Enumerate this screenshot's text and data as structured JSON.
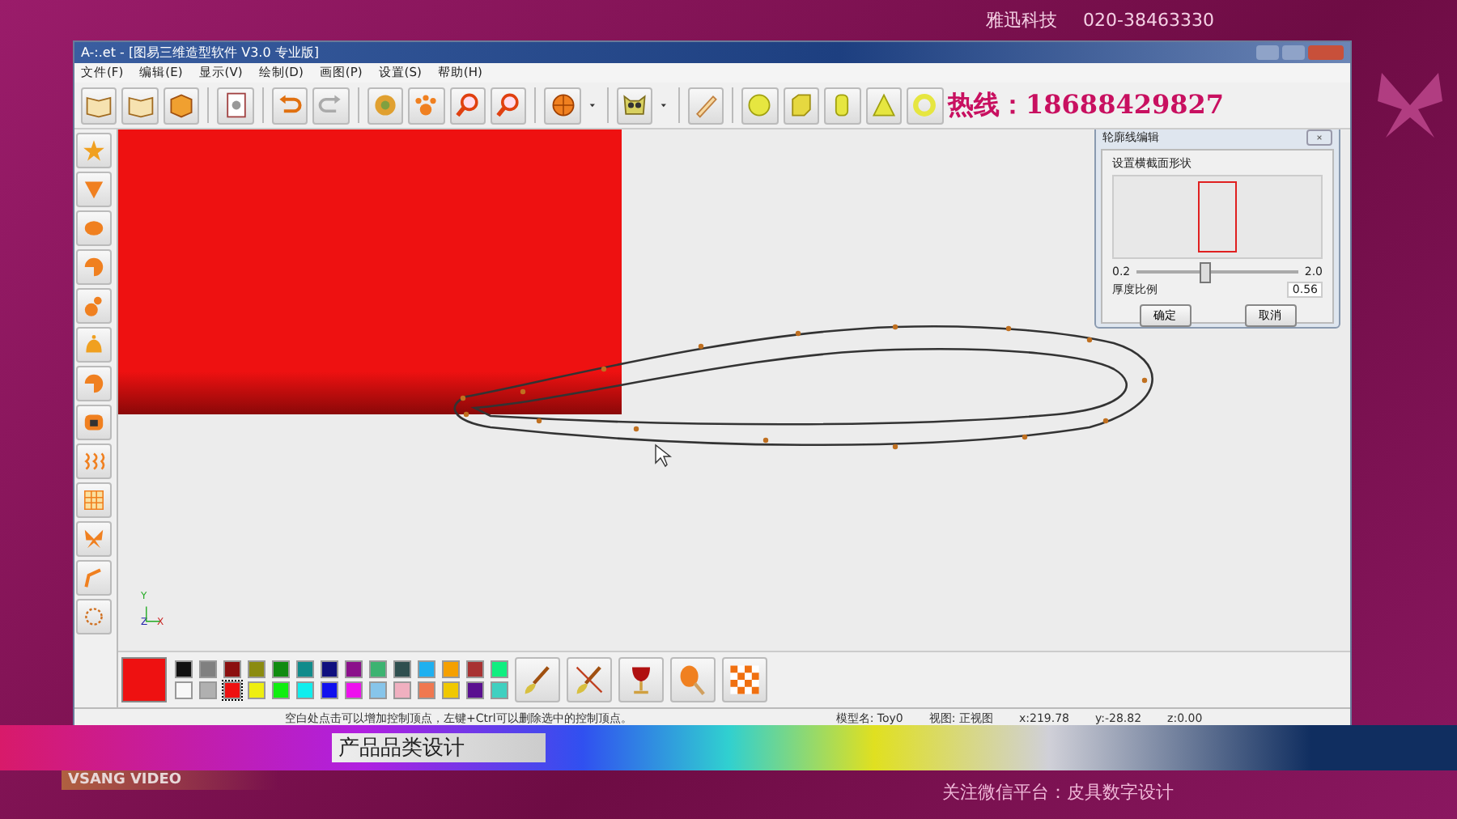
{
  "frame": {
    "company": "雅迅科技",
    "phone": "020-38463330",
    "hotline": "热线：18688429827",
    "banner_title": "产品品类设计",
    "channel": "VSANG VIDEO",
    "follow": "关注微信平台：皮具数字设计"
  },
  "window": {
    "title": "A-:.et - [图易三维造型软件 V3.0 专业版]"
  },
  "menu": [
    "文件(F)",
    "编辑(E)",
    "显示(V)",
    "绘制(D)",
    "画图(P)",
    "设置(S)",
    "帮助(H)"
  ],
  "axes": [
    "Y",
    "Z",
    "X"
  ],
  "dialog": {
    "title": "轮廓线编辑",
    "group": "设置横截面形状",
    "min": "0.2",
    "max": "2.0",
    "level": 0.42,
    "label": "厚度比例",
    "value": "0.56",
    "buttons": [
      "确定",
      "取消"
    ]
  },
  "palette": {
    "colors": [
      {
        "color": "#111111",
        "selected": false
      },
      {
        "color": "#808080",
        "selected": false
      },
      {
        "color": "#8b1010",
        "selected": false
      },
      {
        "color": "#8b8b10",
        "selected": false
      },
      {
        "color": "#108b10",
        "selected": false
      },
      {
        "color": "#108b8b",
        "selected": false
      },
      {
        "color": "#10107f",
        "selected": false
      },
      {
        "color": "#8b108b",
        "selected": false
      },
      {
        "color": "#3cb371",
        "selected": false
      },
      {
        "color": "#2f4f4f",
        "selected": false
      },
      {
        "color": "#1eb0f0",
        "selected": false
      },
      {
        "color": "#f5a000",
        "selected": false
      },
      {
        "color": "#a83232",
        "selected": false
      },
      {
        "color": "#10ee80",
        "selected": false
      },
      {
        "color": "#f8f8f8",
        "selected": false
      },
      {
        "color": "#b0b0b0",
        "selected": false
      },
      {
        "color": "#ee1111",
        "selected": true
      },
      {
        "color": "#eeee10",
        "selected": false
      },
      {
        "color": "#10ee10",
        "selected": false
      },
      {
        "color": "#10eeee",
        "selected": false
      },
      {
        "color": "#1010ee",
        "selected": false
      },
      {
        "color": "#ee10ee",
        "selected": false
      },
      {
        "color": "#87c5ea",
        "selected": false
      },
      {
        "color": "#f0b0c0",
        "selected": false
      },
      {
        "color": "#f07850",
        "selected": false
      },
      {
        "color": "#f0c800",
        "selected": false
      },
      {
        "color": "#5a1090",
        "selected": false
      },
      {
        "color": "#40d0c0",
        "selected": false
      }
    ]
  },
  "status": {
    "hint": "空白处点击可以增加控制顶点，左键+Ctrl可以删除选中的控制顶点。",
    "fields": [
      "模型名: Toy0",
      "视图: 正视图",
      "x:219.78",
      "y:-28.82",
      "z:0.00"
    ]
  }
}
